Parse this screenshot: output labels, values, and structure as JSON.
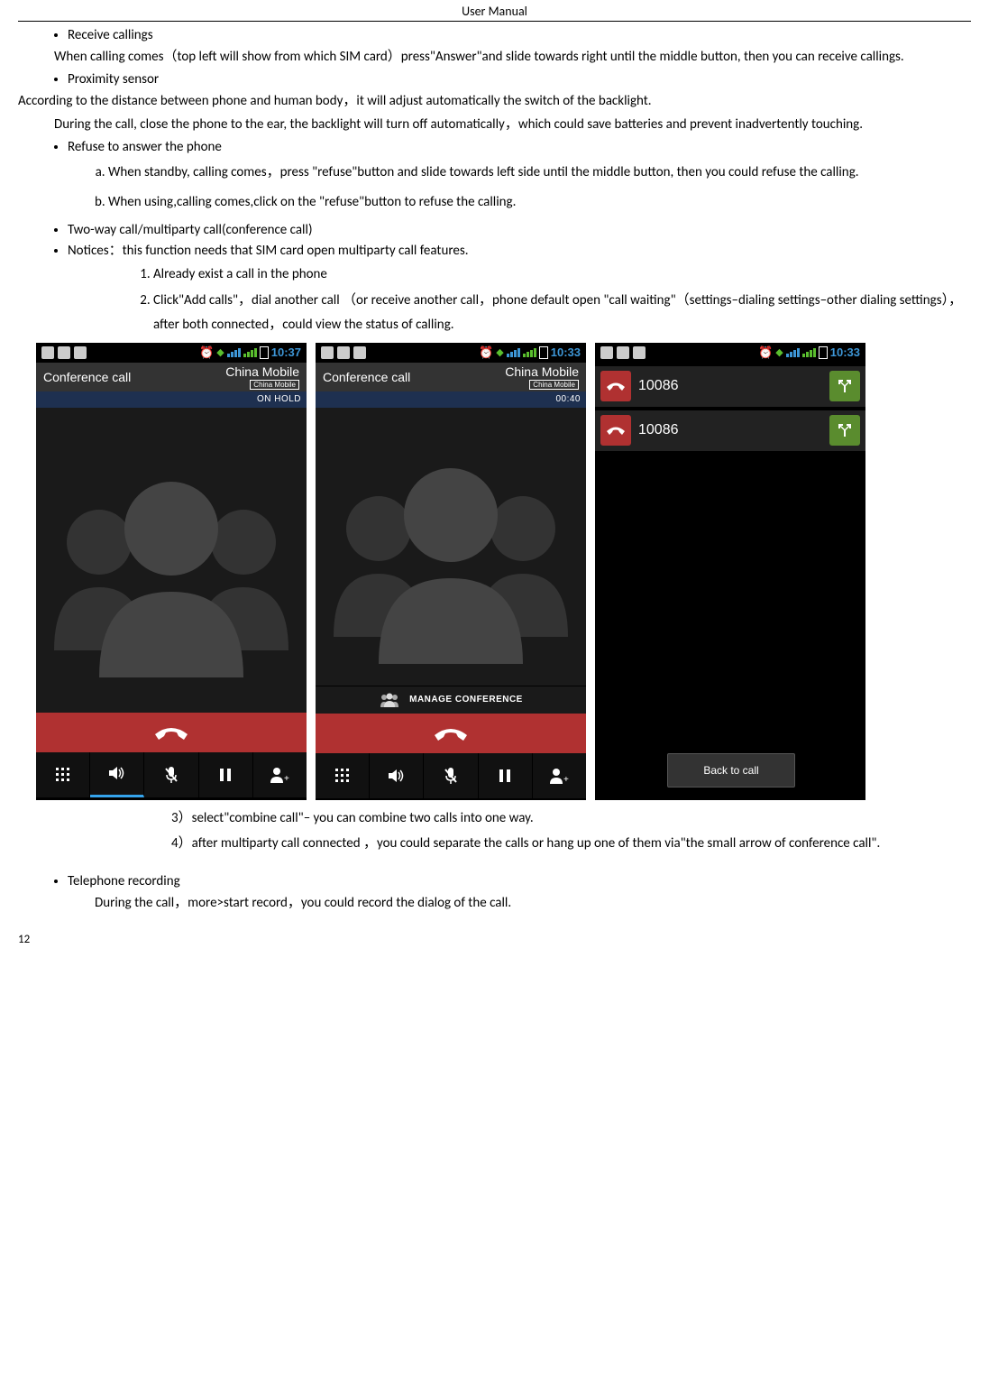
{
  "header": "User    Manual",
  "footer": "12",
  "bullets": {
    "receive": "Receive callings",
    "proximity": "Proximity sensor",
    "refuse": "Refuse to answer the phone",
    "twoway": "Two-way call/multiparty call(conference call)",
    "notices": "Notices：this function needs that SIM card open multiparty call features.",
    "recording": "Telephone recording"
  },
  "text": {
    "receive_p": "When calling comes（top left will show from which SIM card）press\"Answer\"and slide towards right until the middle button, then you can receive callings.",
    "proximity_p1": "According to the distance between phone and human body，it will adjust automatically the switch of the backlight.",
    "proximity_p2": "During the call, close the phone to the ear, the backlight will turn off automatically，which could save batteries and prevent inadvertently touching.",
    "refuse_a": "When standby, calling comes，press \"refuse\"button and slide towards left side until the middle button, then you could refuse the calling.",
    "refuse_b": "When using,calling comes,click on the \"refuse\"button to refuse the calling.",
    "n1": "Already exist a call in the phone",
    "n2": "Click\"Add calls\"，dial another call （or receive another call，phone default open \"call waiting\"（settings–dialing settings–other dialing settings），after both connected，could view the status of calling.",
    "s3": "3）select\"combine call\"– you can combine two calls into one way.",
    "s4": "4）after multiparty call connected ，you could separate the calls or hang up one of them via\"the small arrow of conference call\".",
    "record_p": "During the call，more>start record，you could record the dialog of the call."
  },
  "shot1": {
    "time": "10:37",
    "title": "Conference call",
    "carrier": "China Mobile",
    "carrier_box": "China Mobile",
    "status": "ON HOLD"
  },
  "shot2": {
    "time": "10:33",
    "title": "Conference call",
    "carrier": "China Mobile",
    "carrier_box": "China Mobile",
    "status": "00:40",
    "manage": "MANAGE CONFERENCE"
  },
  "shot3": {
    "time": "10:33",
    "num1": "10086",
    "num2": "10086",
    "back": "Back to call"
  }
}
